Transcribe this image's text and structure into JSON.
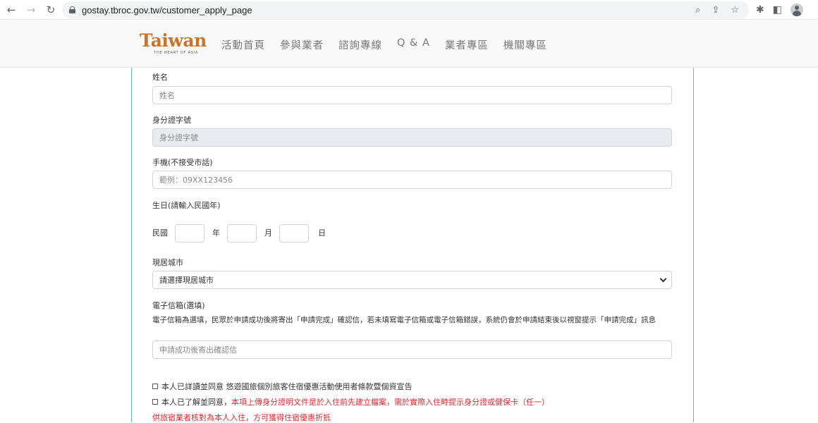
{
  "browser": {
    "url": "gostay.tbroc.gov.tw/customer_apply_page"
  },
  "header": {
    "logo_text": "Taiwan",
    "logo_sub": "THE HEART OF ASIA",
    "nav": [
      "活動首頁",
      "參與業者",
      "諮詢專線",
      "Q & A",
      "業者專區",
      "機關專區"
    ]
  },
  "form": {
    "name": {
      "label": "姓名",
      "placeholder": "姓名"
    },
    "id_number": {
      "label": "身分證字號",
      "placeholder": "身分證字號"
    },
    "mobile": {
      "label": "手機(不接受市話)",
      "placeholder": "範例：09XX123456"
    },
    "birthday": {
      "label": "生日(請輸入民國年)",
      "era": "民國",
      "year": "年",
      "month": "月",
      "day": "日"
    },
    "city": {
      "label": "現居城市",
      "selected": "請選擇現居城市"
    },
    "email": {
      "label": "電子信箱(選填)",
      "note": "電子信箱為選填，民眾於申請成功後將寄出「申請完成」確認信，若未填寫電子信箱或電子信箱錯誤，系統仍會於申請結束後以視窗提示「申請完成」訊息",
      "placeholder": "申請成功後寄出確認信"
    },
    "agree1": "本人已詳讀並同意 悠遊國旅個別旅客住宿優惠活動使用者條款暨個資宣告",
    "agree2_prefix": "本人已了解並同意，",
    "agree2_red": "本項上傳身分證明文件是於入住前先建立檔案，需於實際入住時提示身分證或健保卡（任一）",
    "agree2_tail": "供旅宿業者核對為本人入住，方可獲得住宿優惠折抵"
  }
}
